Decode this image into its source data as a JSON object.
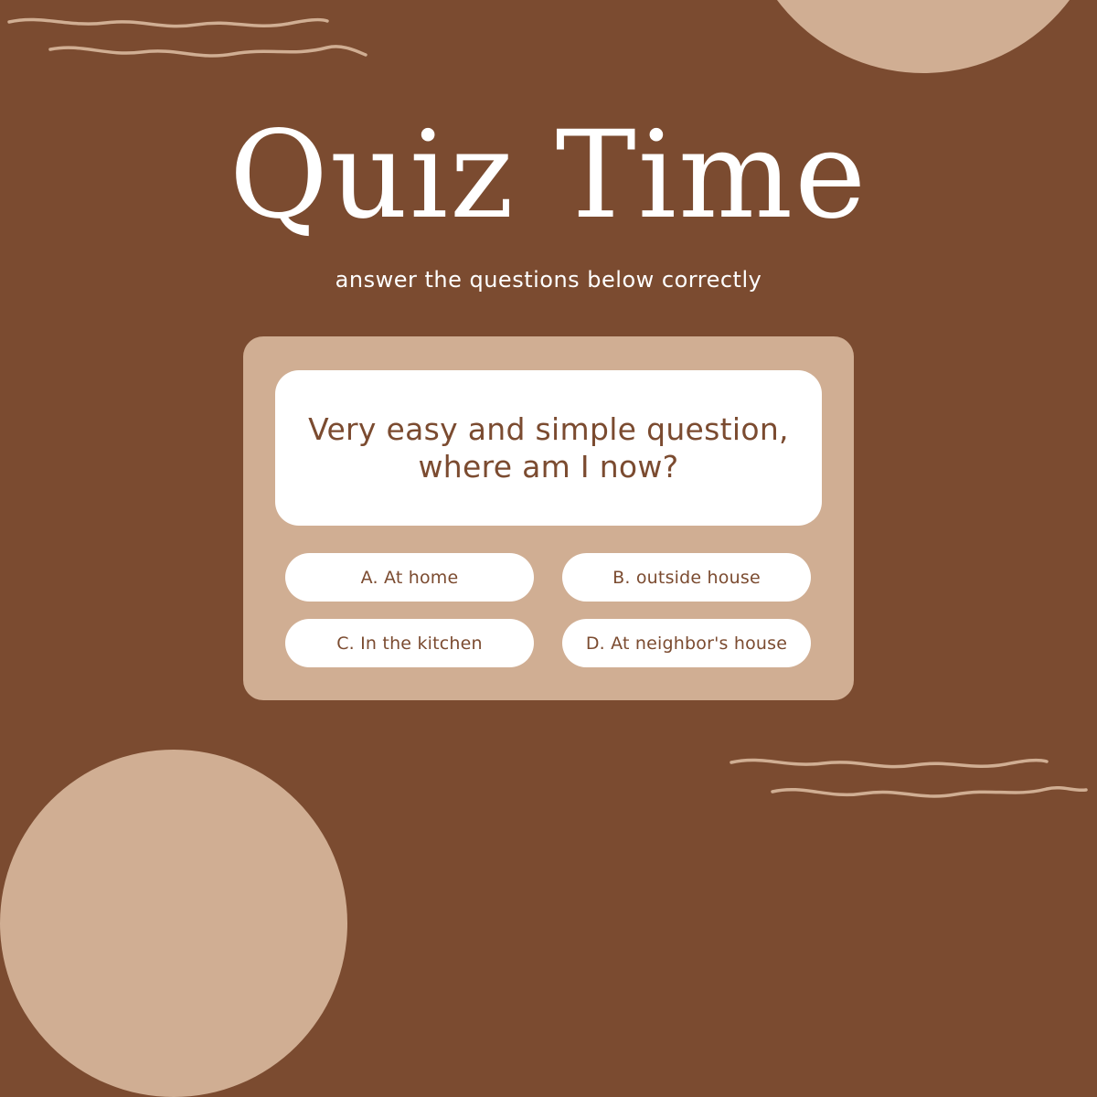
{
  "title": "Quiz Time",
  "subtitle": "answer the questions below correctly",
  "question": "Very easy and simple question, where am I now?",
  "options": [
    {
      "label": "A. At home"
    },
    {
      "label": "B. outside house"
    },
    {
      "label": "C. In the kitchen"
    },
    {
      "label": "D. At neighbor's house"
    }
  ],
  "colors": {
    "background": "#7b4b30",
    "accent": "#d0ae93",
    "text_light": "#ffffff",
    "text_dark": "#7b4b30"
  }
}
